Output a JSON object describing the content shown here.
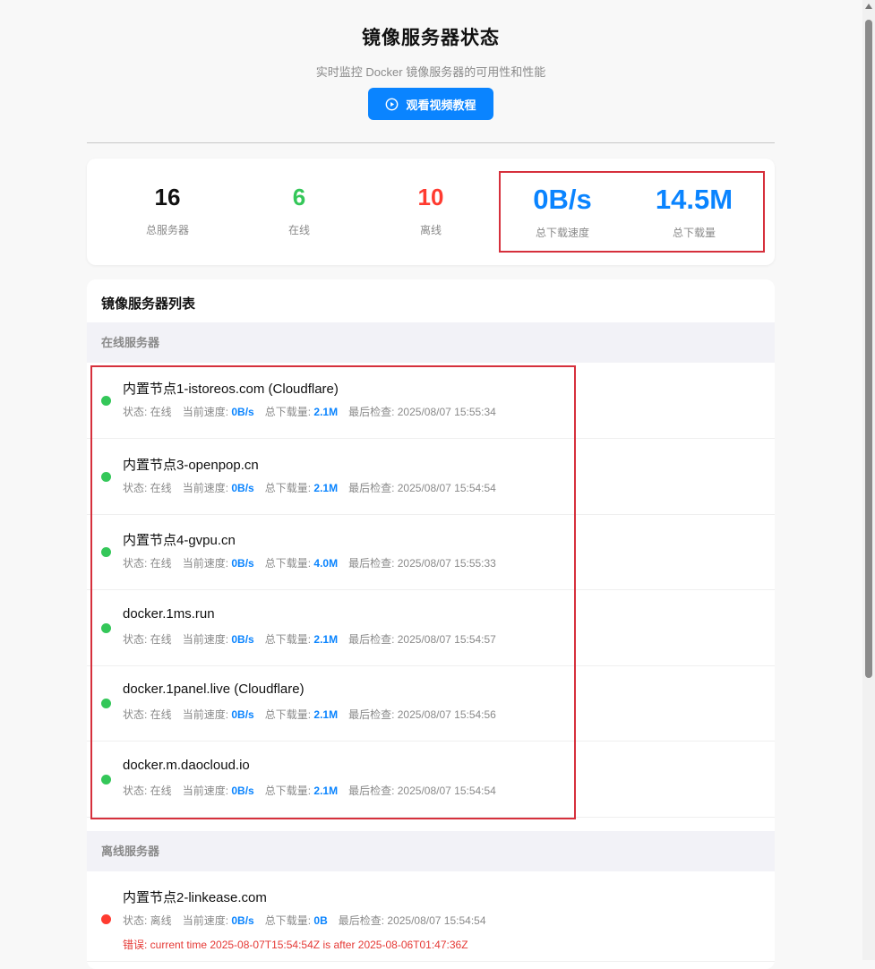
{
  "header": {
    "title": "镜像服务器状态",
    "subtitle": "实时监控 Docker 镜像服务器的可用性和性能",
    "tutorial_button": "观看视频教程"
  },
  "stats": {
    "total_servers": {
      "value": "16",
      "label": "总服务器"
    },
    "online": {
      "value": "6",
      "label": "在线"
    },
    "offline": {
      "value": "10",
      "label": "离线"
    },
    "download_speed": {
      "value": "0B/s",
      "label": "总下载速度"
    },
    "total_download": {
      "value": "14.5M",
      "label": "总下载量"
    }
  },
  "colors": {
    "accent": "#0a84ff",
    "online": "#34c759",
    "offline": "#ff3b30",
    "highlight": "#d6303c"
  },
  "list": {
    "title": "镜像服务器列表",
    "online_section": "在线服务器",
    "offline_section": "离线服务器",
    "labels": {
      "status": "状态:",
      "speed": "当前速度:",
      "download": "总下载量:",
      "last_check": "最后检查:",
      "error": "错误:"
    },
    "online_servers": [
      {
        "name": "内置节点1-istoreos.com (Cloudflare)",
        "status": "在线",
        "speed": "0B/s",
        "download": "2.1M",
        "last_check": "2025/08/07 15:55:34"
      },
      {
        "name": "内置节点3-openpop.cn",
        "status": "在线",
        "speed": "0B/s",
        "download": "2.1M",
        "last_check": "2025/08/07 15:54:54"
      },
      {
        "name": "内置节点4-gvpu.cn",
        "status": "在线",
        "speed": "0B/s",
        "download": "4.0M",
        "last_check": "2025/08/07 15:55:33"
      },
      {
        "name": "docker.1ms.run",
        "status": "在线",
        "speed": "0B/s",
        "download": "2.1M",
        "last_check": "2025/08/07 15:54:57"
      },
      {
        "name": "docker.1panel.live (Cloudflare)",
        "status": "在线",
        "speed": "0B/s",
        "download": "2.1M",
        "last_check": "2025/08/07 15:54:56"
      },
      {
        "name": "docker.m.daocloud.io",
        "status": "在线",
        "speed": "0B/s",
        "download": "2.1M",
        "last_check": "2025/08/07 15:54:54"
      }
    ],
    "offline_servers": [
      {
        "name": "内置节点2-linkease.com",
        "status": "离线",
        "speed": "0B/s",
        "download": "0B",
        "last_check": "2025/08/07 15:54:54",
        "error": "current time 2025-08-07T15:54:54Z is after 2025-08-06T01:47:36Z"
      }
    ]
  }
}
